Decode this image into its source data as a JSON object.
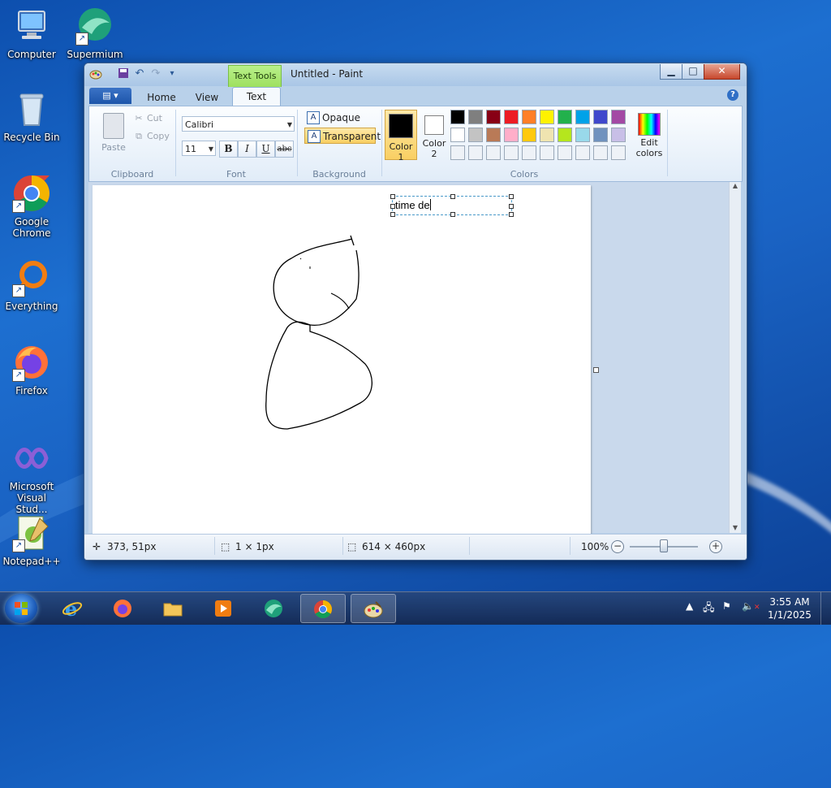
{
  "desktop": {
    "icons": [
      {
        "label": "Computer"
      },
      {
        "label": "Supermium"
      },
      {
        "label": "Recycle Bin"
      },
      {
        "label": "Google Chrome"
      },
      {
        "label": "Everything"
      },
      {
        "label": "Firefox"
      },
      {
        "label": "Microsoft Visual Stud..."
      },
      {
        "label": "Notepad++"
      }
    ]
  },
  "window": {
    "title": "Untitled - Paint",
    "contextual_tab": "Text Tools",
    "tabs": [
      "Home",
      "View",
      "Text"
    ],
    "active_tab": "Text",
    "help": "?"
  },
  "ribbon": {
    "clipboard": {
      "paste": "Paste",
      "cut": "Cut",
      "copy": "Copy",
      "group": "Clipboard"
    },
    "font": {
      "family": "Calibri",
      "size": "11",
      "bold": "B",
      "italic": "I",
      "underline": "U",
      "strike": "abc",
      "group": "Font"
    },
    "background": {
      "opaque": "Opaque",
      "transparent": "Transparent",
      "selected": "Transparent",
      "group": "Background"
    },
    "colors": {
      "color1_label": "Color 1",
      "color2_label": "Color 2",
      "color1": "#000000",
      "color2": "#ffffff",
      "edit_label": "Edit colors",
      "group": "Colors",
      "palette_row1": [
        "#000000",
        "#7f7f7f",
        "#880015",
        "#ed1c24",
        "#ff7f27",
        "#fff200",
        "#22b14c",
        "#00a2e8",
        "#3f48cc",
        "#a349a4"
      ],
      "palette_row2": [
        "#ffffff",
        "#c3c3c3",
        "#b97a57",
        "#ffaec9",
        "#ffc90e",
        "#efe4b0",
        "#b5e61d",
        "#99d9ea",
        "#7092be",
        "#c8bfe7"
      ]
    }
  },
  "canvas": {
    "typed_text": "time de"
  },
  "status": {
    "cursor_pos": "373, 51px",
    "selection_size": "1 × 1px",
    "image_size": "614 × 460px",
    "zoom": "100%"
  },
  "taskbar": {
    "clock_time": "3:55 AM",
    "clock_date": "1/1/2025"
  }
}
